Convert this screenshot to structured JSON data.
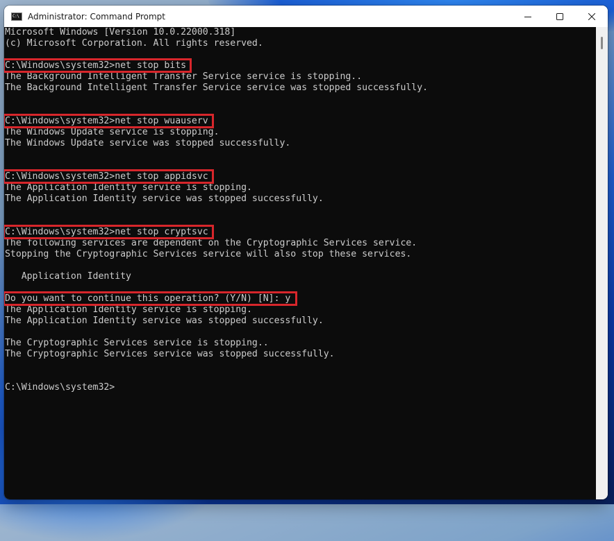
{
  "window": {
    "title": "Administrator: Command Prompt",
    "icon": "cmd-icon",
    "icon_text": "C:\\",
    "controls": {
      "minimize": "minimize-icon",
      "maximize": "maximize-icon",
      "close": "close-icon"
    }
  },
  "console": {
    "text_color": "#cccccc",
    "background": "#0c0c0c",
    "highlight_color": "#d7262b",
    "lines": [
      "Microsoft Windows [Version 10.0.22000.318]",
      "(c) Microsoft Corporation. All rights reserved.",
      "",
      "C:\\Windows\\system32>net stop bits",
      "The Background Intelligent Transfer Service service is stopping..",
      "The Background Intelligent Transfer Service service was stopped successfully.",
      "",
      "",
      "C:\\Windows\\system32>net stop wuauserv",
      "The Windows Update service is stopping.",
      "The Windows Update service was stopped successfully.",
      "",
      "",
      "C:\\Windows\\system32>net stop appidsvc",
      "The Application Identity service is stopping.",
      "The Application Identity service was stopped successfully.",
      "",
      "",
      "C:\\Windows\\system32>net stop cryptsvc",
      "The following services are dependent on the Cryptographic Services service.",
      "Stopping the Cryptographic Services service will also stop these services.",
      "",
      "   Application Identity",
      "",
      "Do you want to continue this operation? (Y/N) [N]: y",
      "The Application Identity service is stopping.",
      "The Application Identity service was stopped successfully.",
      "",
      "The Cryptographic Services service is stopping..",
      "The Cryptographic Services service was stopped successfully.",
      "",
      "",
      "C:\\Windows\\system32>"
    ],
    "highlighted_lines": [
      3,
      8,
      13,
      18,
      24
    ]
  }
}
